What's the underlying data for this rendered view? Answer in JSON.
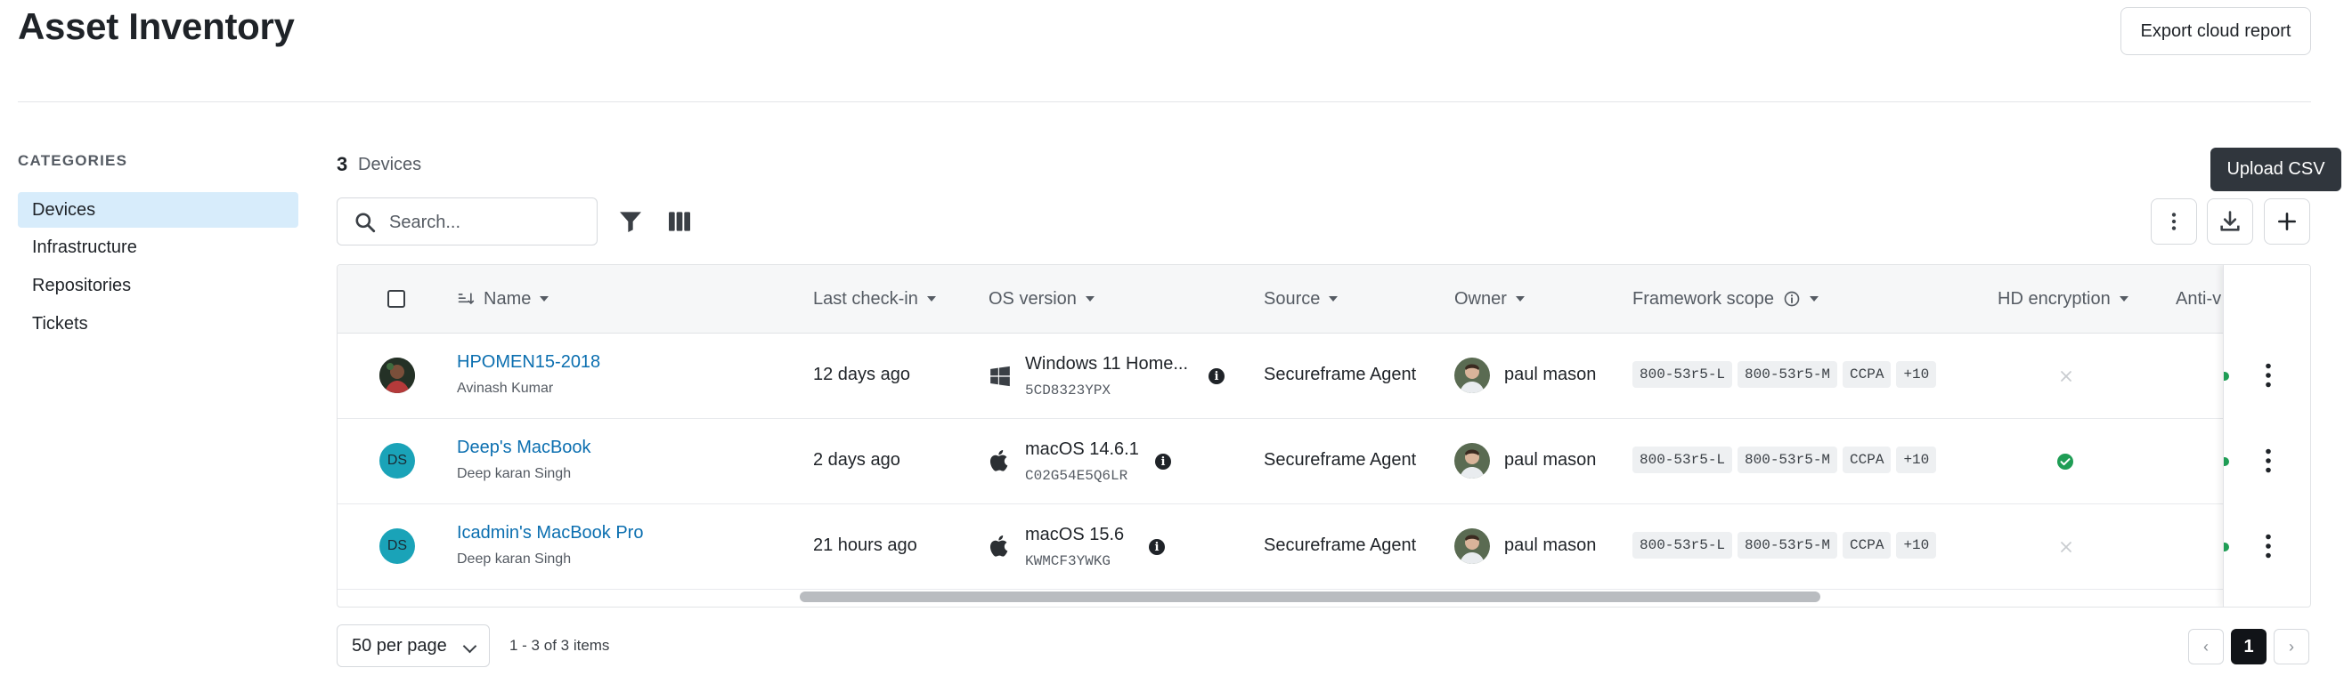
{
  "page": {
    "title": "Asset Inventory",
    "export_label": "Export cloud report"
  },
  "categories": {
    "heading": "CATEGORIES",
    "items": [
      {
        "label": "Devices",
        "active": true
      },
      {
        "label": "Infrastructure",
        "active": false
      },
      {
        "label": "Repositories",
        "active": false
      },
      {
        "label": "Tickets",
        "active": false
      }
    ]
  },
  "summary": {
    "count": "3",
    "unit": "Devices"
  },
  "search": {
    "placeholder": "Search...",
    "value": ""
  },
  "toolbar": {
    "tooltip": "Upload CSV",
    "icons": [
      "filter-icon",
      "columns-icon",
      "more-vertical-icon",
      "download-icon",
      "plus-icon"
    ]
  },
  "table": {
    "columns": {
      "name": "Name",
      "last_checkin": "Last check-in",
      "os_version": "OS version",
      "source": "Source",
      "owner": "Owner",
      "framework_scope": "Framework scope",
      "hd_encryption": "HD encryption",
      "anti": "Anti-v"
    },
    "rows": [
      {
        "name": "HPOMEN15-2018",
        "user": "Avinash Kumar",
        "avatar": "photo",
        "last_checkin": "12 days ago",
        "os_icon": "windows-icon",
        "os": "Windows 11 Home...",
        "serial": "5CD8323YPX",
        "source": "Secureframe Agent",
        "owner": "paul mason",
        "scopes": [
          "800-53r5-L",
          "800-53r5-M",
          "CCPA",
          "+10"
        ],
        "hd_encryption": "no"
      },
      {
        "name": "Deep's MacBook",
        "user": "Deep karan Singh",
        "avatar": "DS",
        "last_checkin": "2 days ago",
        "os_icon": "apple-icon",
        "os": "macOS 14.6.1",
        "serial": "C02G54E5Q6LR",
        "source": "Secureframe Agent",
        "owner": "paul mason",
        "scopes": [
          "800-53r5-L",
          "800-53r5-M",
          "CCPA",
          "+10"
        ],
        "hd_encryption": "yes"
      },
      {
        "name": "Icadmin's MacBook Pro",
        "user": "Deep karan Singh",
        "avatar": "DS",
        "last_checkin": "21 hours ago",
        "os_icon": "apple-icon",
        "os": "macOS 15.6",
        "serial": "KWMCF3YWKG",
        "source": "Secureframe Agent",
        "owner": "paul mason",
        "scopes": [
          "800-53r5-L",
          "800-53r5-M",
          "CCPA",
          "+10"
        ],
        "hd_encryption": "no"
      }
    ]
  },
  "pagination": {
    "per_page": "50 per page",
    "range": "1 - 3 of 3 items",
    "current": "1",
    "prev": "‹",
    "next": "›"
  },
  "colors": {
    "accent": "#0b6fb0",
    "active_bg": "#d7ecfb",
    "success": "#1f9d55",
    "avatar_teal": "#1aa3b8",
    "tooltip_bg": "#30363d"
  }
}
